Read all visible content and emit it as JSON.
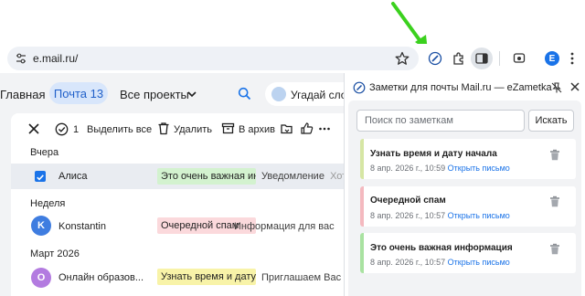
{
  "browser": {
    "url": "e.mail.ru/",
    "profile_initial": "E",
    "accent": "#1a73e8"
  },
  "mail": {
    "nav": {
      "home": "Главная",
      "inbox": "Почта 13",
      "projects": "Все проекты",
      "guess": "Угадай сло"
    },
    "actions": {
      "count": "1",
      "select_all": "Выделить все",
      "delete": "Удалить",
      "archive": "В архив"
    },
    "groups": [
      {
        "label": "Вчера"
      },
      {
        "label": "Неделя"
      },
      {
        "label": "Март 2026"
      }
    ],
    "rows": [
      {
        "sender": "Алиса",
        "tag": "Это очень важная ин...",
        "subject": "Уведомление",
        "subject_tail": "Хот...",
        "selected": true
      },
      {
        "sender": "Konstantin",
        "avatar": "K",
        "avatar_color": "#3f7de0",
        "tag": "Очередной спам",
        "subject": "Информация для вас",
        "selected": false
      },
      {
        "sender": "Онлайн образов...",
        "avatar": "О",
        "avatar_color": "#b37be0",
        "tag": "Узнать время и дату ...",
        "subject": "Приглашаем Вас",
        "selected": false
      }
    ]
  },
  "panel": {
    "title": "Заметки для почты Mail.ru — eZametka",
    "search_placeholder": "Поиск по заметкам",
    "search_button": "Искать",
    "notes": [
      {
        "title": "Узнать время и дату начала",
        "date": "8 апр. 2026 г., 10:59",
        "link": "Открыть письмо",
        "color": "#d6e6a4"
      },
      {
        "title": "Очередной спам",
        "date": "8 апр. 2026 г., 10:57",
        "link": "Открыть письмо",
        "color": "#f4b9bf"
      },
      {
        "title": "Это очень важная информация",
        "date": "8 апр. 2026 г., 10:57",
        "link": "Открыть письмо",
        "color": "#a9e2a1"
      }
    ]
  }
}
